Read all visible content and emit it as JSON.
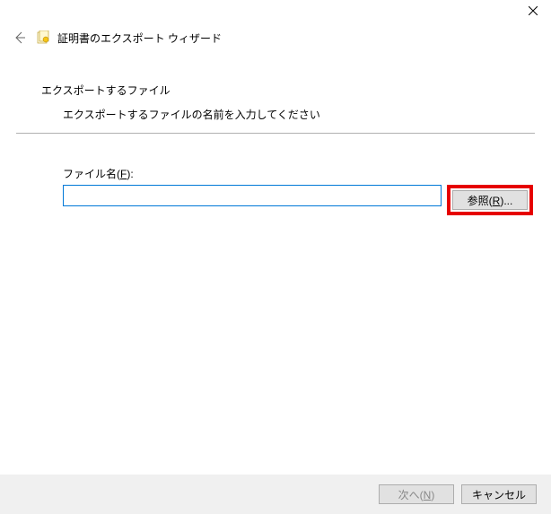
{
  "window": {
    "title": "証明書のエクスポート ウィザード"
  },
  "page": {
    "section_title": "エクスポートするファイル",
    "section_sub": "エクスポートするファイルの名前を入力してください"
  },
  "field": {
    "label_prefix": "ファイル名(",
    "label_key": "F",
    "label_suffix": "):",
    "value": ""
  },
  "buttons": {
    "browse_prefix": "参照(",
    "browse_key": "R",
    "browse_suffix": ")...",
    "next_prefix": "次へ(",
    "next_key": "N",
    "next_suffix": ")",
    "cancel": "キャンセル"
  }
}
